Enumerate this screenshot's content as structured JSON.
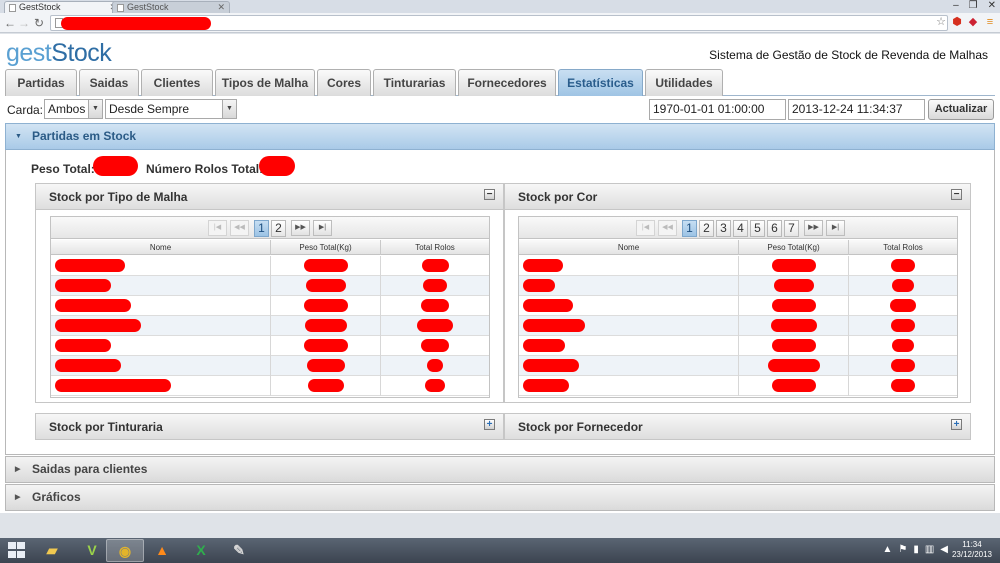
{
  "browser": {
    "tabs": [
      {
        "title": "GestStock",
        "active": true
      },
      {
        "title": "GestStock",
        "active": false
      }
    ]
  },
  "app": {
    "logo": {
      "part1": "gest",
      "part2": "Stock"
    },
    "subtitle": "Sistema de Gestão de Stock de Revenda de Malhas",
    "tabs": [
      {
        "label": "Partidas"
      },
      {
        "label": "Saidas"
      },
      {
        "label": "Clientes"
      },
      {
        "label": "Tipos de Malha"
      },
      {
        "label": "Cores"
      },
      {
        "label": "Tinturarias"
      },
      {
        "label": "Fornecedores"
      },
      {
        "label": "Estatísticas",
        "active": true
      },
      {
        "label": "Utilidades"
      }
    ],
    "filters": {
      "carda_label": "Carda:",
      "carda_value": "Ambos",
      "period_value": "Desde Sempre",
      "date_from": "1970-01-01 01:00:00",
      "date_to": "2013-12-24 11:34:37",
      "refresh_label": "Actualizar"
    },
    "sections": {
      "stock": "Partidas em Stock",
      "saidas": "Saidas para clientes",
      "graficos": "Gráficos"
    },
    "totals": {
      "peso_label": "Peso Total:",
      "rolos_label": "Número Rolos Total:"
    },
    "panels": {
      "tipo_malha": {
        "title": "Stock por Tipo de Malha",
        "pages": [
          "1",
          "2"
        ],
        "current_page": "1",
        "columns": [
          "Nome",
          "Peso Total(Kg)",
          "Total Rolos"
        ],
        "row_count": 7
      },
      "cor": {
        "title": "Stock por Cor",
        "pages": [
          "1",
          "2",
          "3",
          "4",
          "5",
          "6",
          "7"
        ],
        "current_page": "1",
        "columns": [
          "Nome",
          "Peso Total(Kg)",
          "Total Rolos"
        ],
        "row_count": 7
      },
      "tinturaria": {
        "title": "Stock por Tinturaria"
      },
      "fornecedor": {
        "title": "Stock por Fornecedor"
      }
    }
  },
  "taskbar": {
    "time": "11:34",
    "date": "23/12/2013"
  },
  "colors": {
    "accent": "#5aa0d2",
    "active_tab": "#9fc4e4",
    "redaction": "#ff0000"
  }
}
